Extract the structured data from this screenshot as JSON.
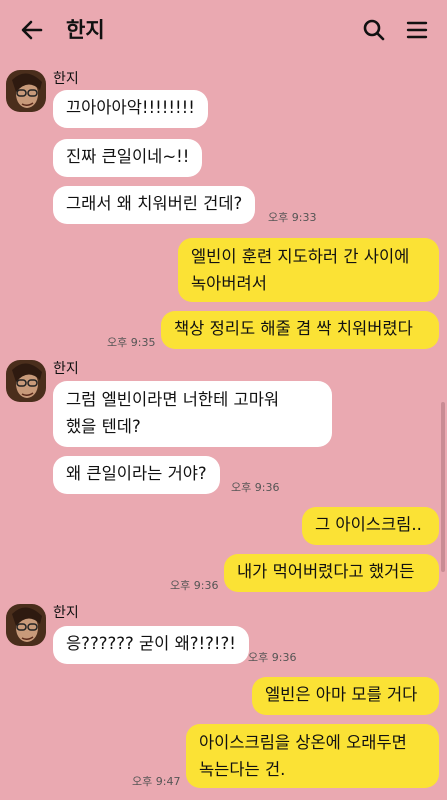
{
  "header": {
    "title": "한지",
    "back_icon": "arrow-left-icon",
    "search_icon": "search-icon",
    "menu_icon": "hamburger-menu-icon"
  },
  "colors": {
    "background": "#eaa9b1",
    "incoming_bubble": "#ffffff",
    "outgoing_bubble": "#fbe235"
  },
  "messages": {
    "g1": {
      "sender": "한지",
      "m1": "끄아아아악!!!!!!!!",
      "m2": "진짜 큰일이네~!!",
      "m3": "그래서 왜 치워버린 건데?",
      "time": "오후 9:33"
    },
    "o1": {
      "m1_line1": "엘빈이 훈련 지도하러 간 사이에",
      "m1_line2": "녹아버려서",
      "m2": "책상 정리도 해줄 겸 싹 치워버렸다",
      "time": "오후 9:35"
    },
    "g2": {
      "sender": "한지",
      "m1_line1": "그럼 엘빈이라면 너한테 고마워",
      "m1_line2": "했을 텐데?",
      "m2": "왜 큰일이라는 거야?",
      "time": "오후 9:36"
    },
    "o2": {
      "m1": "그 아이스크림..",
      "m2": "내가 먹어버렸다고 했거든",
      "time": "오후 9:36"
    },
    "g3": {
      "sender": "한지",
      "m1": "응?????? 굳이 왜?!?!?!",
      "time": "오후 9:36"
    },
    "o3": {
      "m1": "엘빈은 아마 모를 거다",
      "m2_line1": "아이스크림을 상온에 오래두면",
      "m2_line2": "녹는다는 건.",
      "time": "오후 9:47"
    }
  }
}
